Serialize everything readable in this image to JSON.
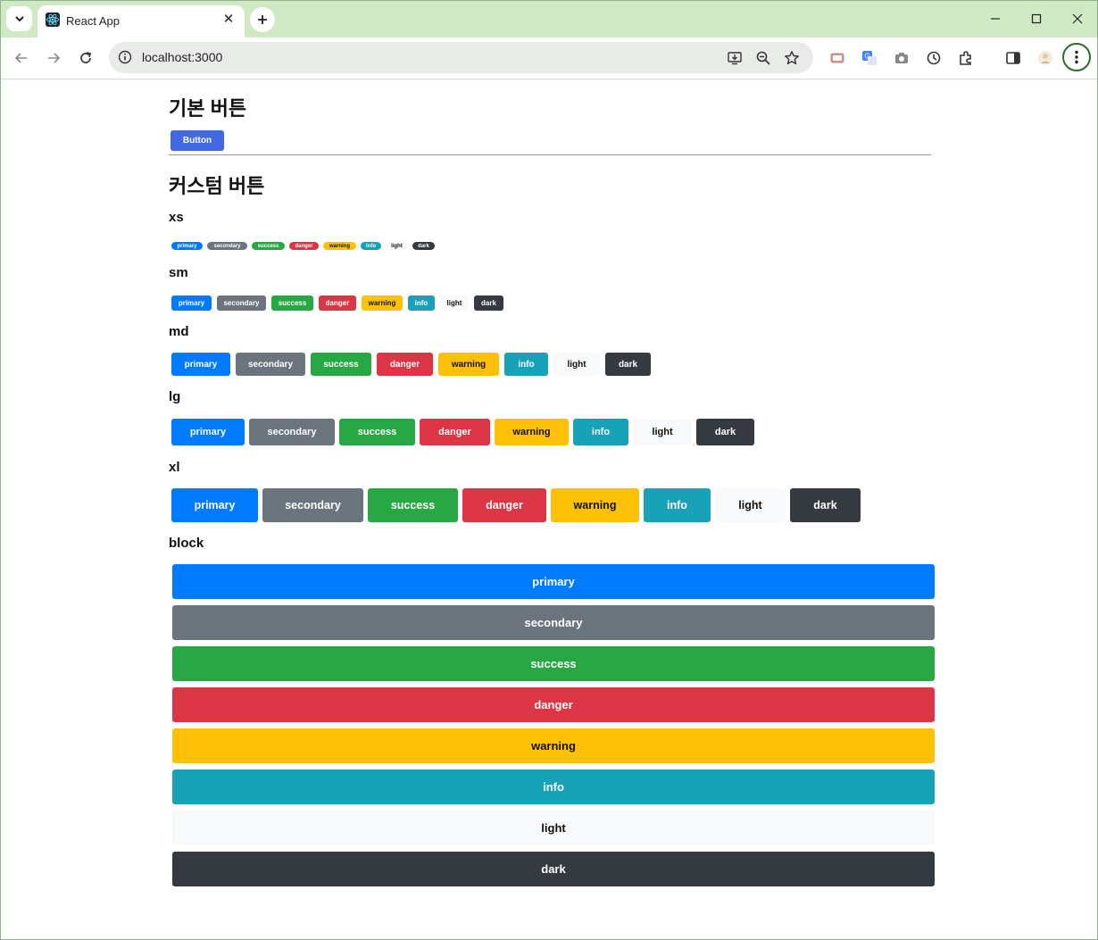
{
  "browser": {
    "tab_title": "React App",
    "url": "localhost:3000"
  },
  "page": {
    "basic_heading": "기본 버튼",
    "basic_button": "Button",
    "custom_heading": "커스텀 버튼",
    "sizes": [
      {
        "label": "xs",
        "buttons": [
          "primary",
          "secondary",
          "success",
          "danger",
          "warning",
          "info",
          "light",
          "dark"
        ]
      },
      {
        "label": "sm",
        "buttons": [
          "primary",
          "secondary",
          "success",
          "danger",
          "warning",
          "info",
          "light",
          "dark"
        ]
      },
      {
        "label": "md",
        "buttons": [
          "primary",
          "secondary",
          "success",
          "danger",
          "warning",
          "info",
          "light",
          "dark"
        ]
      },
      {
        "label": "lg",
        "buttons": [
          "primary",
          "secondary",
          "success",
          "danger",
          "warning",
          "info",
          "light",
          "dark"
        ]
      },
      {
        "label": "xl",
        "buttons": [
          "primary",
          "secondary",
          "success",
          "danger",
          "warning",
          "info",
          "light",
          "dark"
        ]
      }
    ],
    "block": {
      "label": "block",
      "buttons": [
        "primary",
        "secondary",
        "success",
        "danger",
        "warning",
        "info",
        "light",
        "dark"
      ]
    }
  },
  "colors": {
    "basic_button": "#4169e1",
    "primary": "#007bff",
    "secondary": "#6c757d",
    "success": "#28a745",
    "danger": "#dc3545",
    "warning": "#ffc107",
    "info": "#17a2b8",
    "light": "#f8f9fa",
    "dark": "#343a40",
    "tabstrip": "#cfe9c4"
  },
  "icons": {
    "tab_search": "chevron-down-icon",
    "favicon": "react-icon",
    "close": "close-icon",
    "new_tab": "plus-icon",
    "back": "back-arrow-icon",
    "forward": "forward-arrow-icon",
    "reload": "reload-icon",
    "site_info": "info-icon",
    "install": "install-app-icon",
    "zoom": "zoom-icon",
    "bookmark": "star-icon",
    "menu": "kebab-menu-icon"
  }
}
